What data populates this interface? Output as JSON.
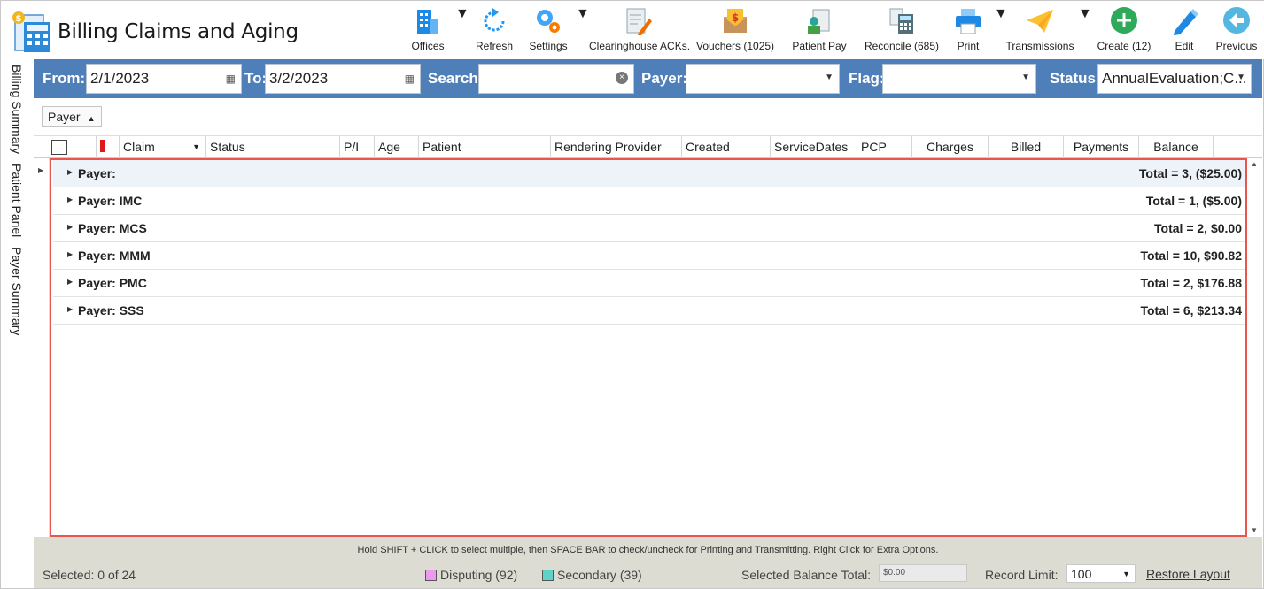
{
  "app": {
    "title": "Billing Claims and Aging"
  },
  "toolbar": {
    "items": [
      {
        "label": "Offices"
      },
      {
        "label": "Refresh"
      },
      {
        "label": "Settings"
      },
      {
        "label": "Clearinghouse ACKs."
      },
      {
        "label": "Vouchers (1025)"
      },
      {
        "label": "Patient Pay"
      },
      {
        "label": "Reconcile (685)"
      },
      {
        "label": "Print"
      },
      {
        "label": "Transmissions"
      },
      {
        "label": "Create (12)"
      },
      {
        "label": "Edit"
      },
      {
        "label": "Previous"
      }
    ]
  },
  "filters": {
    "from_label": "From:",
    "from_value": "2/1/2023",
    "to_label": "To:",
    "to_value": "3/2/2023",
    "search_label": "Search:",
    "search_value": "",
    "payer_label": "Payer:",
    "payer_value": "",
    "flag_label": "Flag:",
    "flag_value": "",
    "status_label": "Status:",
    "status_value": "AnnualEvaluation;C..."
  },
  "sidetabs": [
    "Billing Summary",
    "Patient Panel",
    "Payer Summary"
  ],
  "group_panel": {
    "chip": "Payer"
  },
  "columns": [
    "Claim",
    "Status",
    "P/I",
    "Age",
    "Patient",
    "Rendering Provider",
    "Created",
    "ServiceDates",
    "PCP",
    "Charges",
    "Billed",
    "Payments",
    "Balance"
  ],
  "groups": [
    {
      "name": "Payer:",
      "total": "Total = 3,  ($25.00)"
    },
    {
      "name": "Payer: IMC",
      "total": "Total = 1,  ($5.00)"
    },
    {
      "name": "Payer: MCS",
      "total": "Total = 2,  $0.00"
    },
    {
      "name": "Payer: MMM",
      "total": "Total = 10,  $90.82"
    },
    {
      "name": "Payer: PMC",
      "total": "Total = 2,  $176.88"
    },
    {
      "name": "Payer: SSS",
      "total": "Total = 6,  $213.34"
    }
  ],
  "statusbar": {
    "hint": "Hold SHIFT + CLICK to select multiple, then SPACE BAR to check/uncheck for Printing and Transmitting. Right Click for Extra Options.",
    "selected": "Selected: 0 of 24",
    "disputing": "Disputing (92)",
    "secondary": "Secondary (39)",
    "balance_label": "Selected Balance Total:",
    "balance_value": "$0.00",
    "record_limit_label": "Record Limit:",
    "record_limit_value": "100",
    "restore_label": "Restore Layout"
  },
  "colors": {
    "filter_bar": "#4f7fb8",
    "highlight_border": "#e8574f",
    "disputing": "#ee99f0",
    "secondary": "#5fd3c8",
    "flag": "#e01818"
  }
}
